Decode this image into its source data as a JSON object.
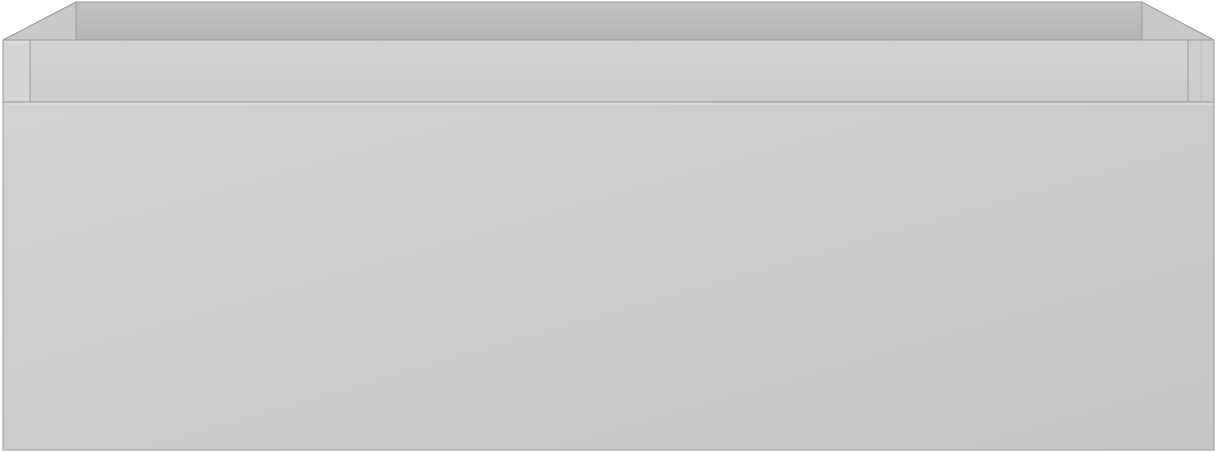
{
  "object": {
    "name": "Drawer",
    "colors": {
      "outline": "#9b9b9b",
      "back_wall": "#b7b7b7",
      "back_wall_top": "#c4c4c4",
      "side_inner": "#bdbdbd",
      "rim_left": "#d6d6d6",
      "rim_edge": "#c8c8c8",
      "inner_band": "#cfcfcf",
      "front_panel_light": "#d2d2d2",
      "front_panel_dark": "#c6c6c6",
      "highlight": "#e4e4e4"
    }
  }
}
